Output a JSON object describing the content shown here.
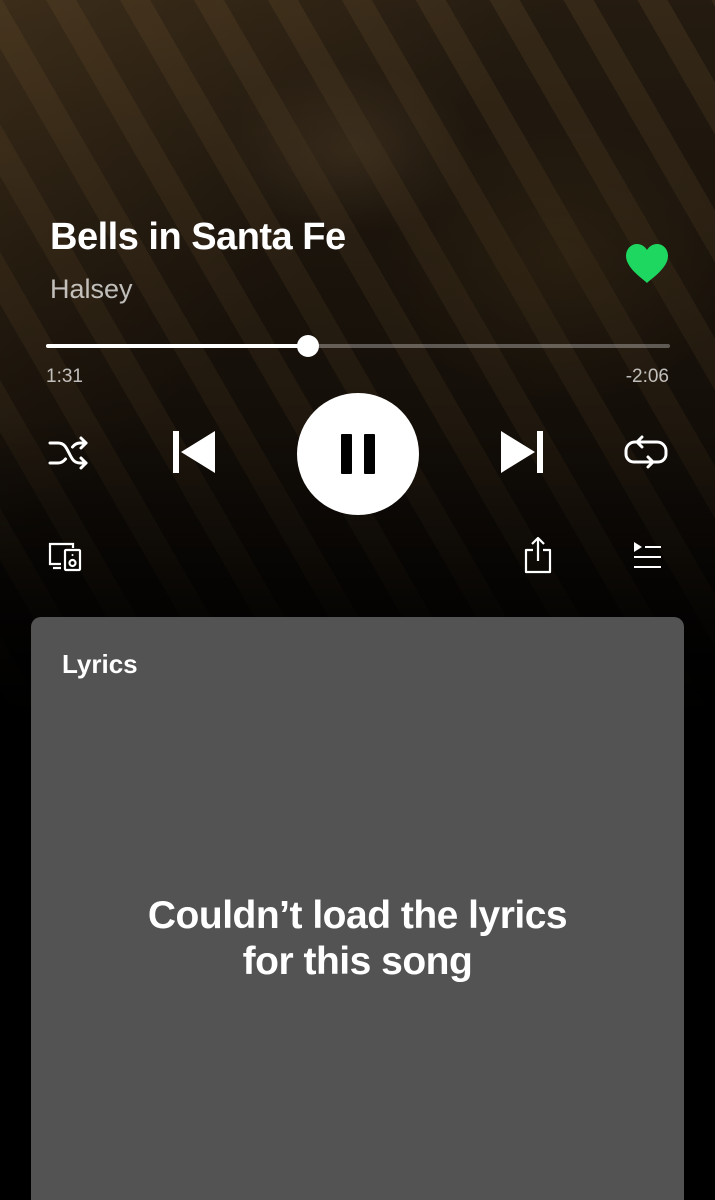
{
  "track": {
    "title": "Bells in Santa Fe",
    "artist": "Halsey",
    "liked": true
  },
  "playback": {
    "elapsed": "1:31",
    "remaining": "-2:06",
    "progress_fraction": 0.42,
    "state": "playing"
  },
  "controls": {
    "shuffle_icon": "shuffle-icon",
    "previous_icon": "skip-previous-icon",
    "pause_icon": "pause-icon",
    "next_icon": "skip-next-icon",
    "repeat_icon": "repeat-icon",
    "devices_icon": "devices-icon",
    "share_icon": "share-icon",
    "queue_icon": "queue-icon"
  },
  "lyrics": {
    "heading": "Lyrics",
    "message": "Couldn’t load the lyrics for this song"
  },
  "colors": {
    "accent_green": "#1ed760",
    "lyrics_card_bg": "#535353"
  }
}
